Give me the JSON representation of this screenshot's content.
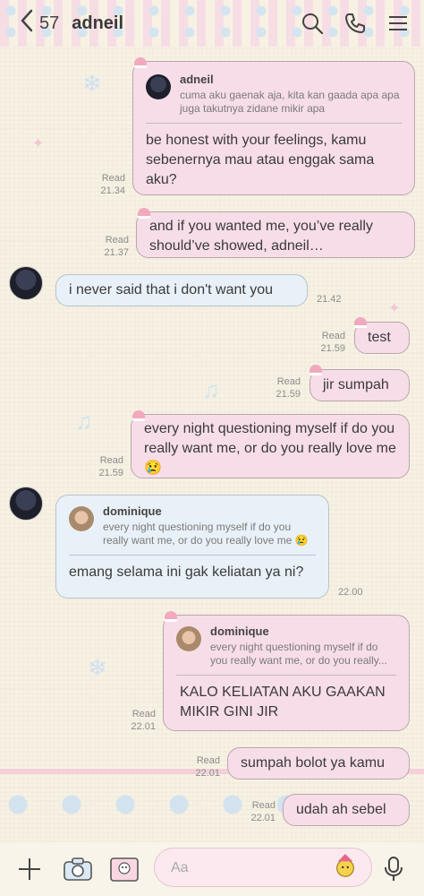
{
  "header": {
    "back_count": "57",
    "chat_title": "adneil",
    "icons": [
      "back-chevron-icon",
      "search-icon",
      "phone-icon",
      "menu-icon"
    ]
  },
  "messages": [
    {
      "id": "m1",
      "side": "out",
      "reply": {
        "name": "adneil",
        "text": "cuma aku gaenak aja, kita kan gaada apa apa juga takutnya zidane mikir apa"
      },
      "text": "be honest with your feelings, kamu sebenernya mau atau enggak sama aku?",
      "status": "Read",
      "time": "21.34"
    },
    {
      "id": "m2",
      "side": "out",
      "text": "and if you wanted me, you’ve really should’ve showed, adneil…",
      "status": "Read",
      "time": "21.37"
    },
    {
      "id": "m3",
      "side": "in",
      "text": "i never said that i don't want you",
      "time": "21.42"
    },
    {
      "id": "m4",
      "side": "out",
      "text": "test",
      "status": "Read",
      "time": "21.59"
    },
    {
      "id": "m5",
      "side": "out",
      "text": "jir sumpah",
      "status": "Read",
      "time": "21.59"
    },
    {
      "id": "m6",
      "side": "out",
      "text": "every night questioning myself if do you really want me, or do you really love me 😢",
      "status": "Read",
      "time": "21.59"
    },
    {
      "id": "m7",
      "side": "in",
      "reply": {
        "name": "dominique",
        "text": "every night questioning myself if do you really want me, or do you really love me 😢"
      },
      "text": "emang selama ini gak keliatan ya ni?",
      "time": "22.00"
    },
    {
      "id": "m8",
      "side": "out",
      "reply": {
        "name": "dominique",
        "text": "every night questioning myself if do you really want me, or do you really..."
      },
      "text": "KALO KELIATAN AKU GAAKAN MIKIR GINI JIR",
      "status": "Read",
      "time": "22.01"
    },
    {
      "id": "m9",
      "side": "out",
      "text": "sumpah bolot ya kamu",
      "status": "Read",
      "time": "22.01"
    },
    {
      "id": "m10",
      "side": "out",
      "text": "udah ah sebel",
      "status": "Read",
      "time": "22.01"
    }
  ],
  "composer": {
    "placeholder": "Aa",
    "icons": [
      "plus-icon",
      "camera-icon",
      "image-icon",
      "sticker-icon",
      "microphone-icon"
    ]
  },
  "colors": {
    "outgoing_bubble": "#f7dde8",
    "incoming_bubble": "#e9f1f8",
    "background": "#f8f2e4"
  }
}
